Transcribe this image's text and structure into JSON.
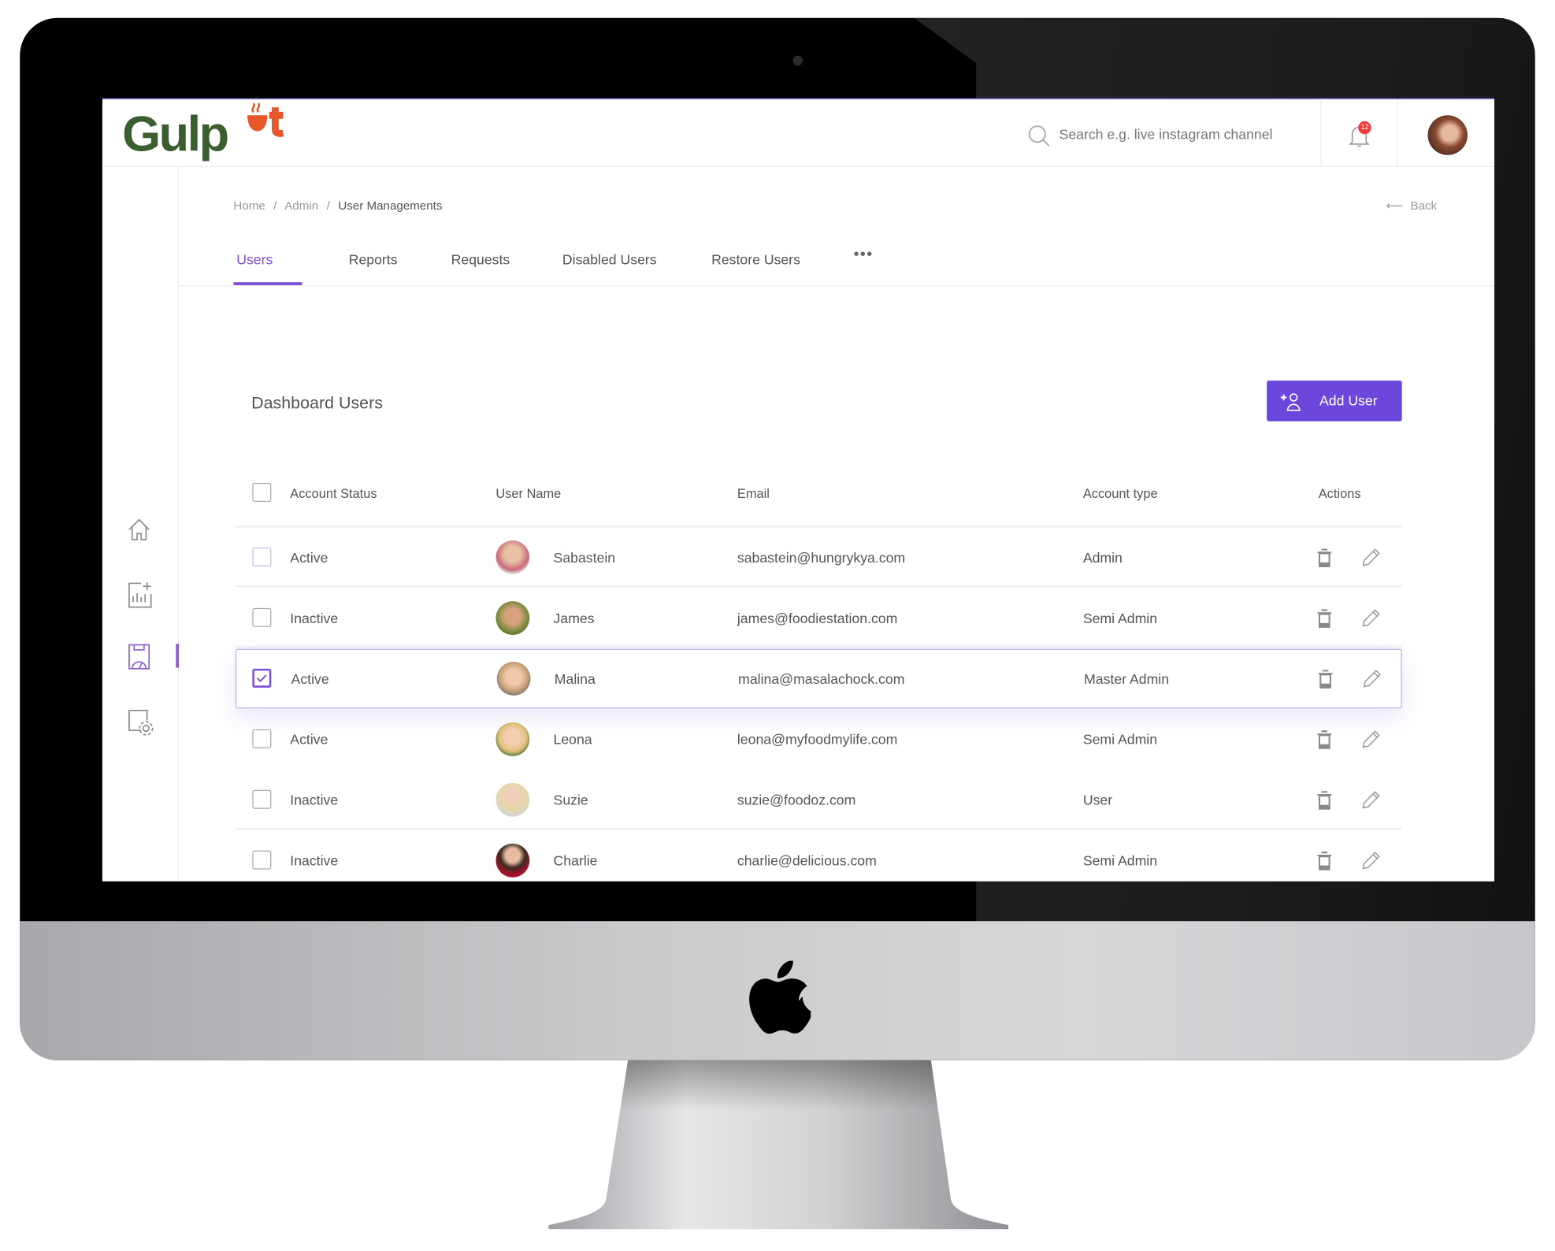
{
  "app": {
    "logo_text": "GulpOut",
    "brand_colors": {
      "green": "#3b5e31",
      "orange": "#e8572a",
      "accent": "#6c47dc"
    }
  },
  "header": {
    "search_placeholder": "Search e.g. live instagram channel",
    "notification_count": "12"
  },
  "sidebar": {
    "items": [
      {
        "icon": "home-icon"
      },
      {
        "icon": "chart-add-icon"
      },
      {
        "icon": "dashboard-icon",
        "active": true
      },
      {
        "icon": "settings-file-icon"
      }
    ]
  },
  "breadcrumb": {
    "items": [
      "Home",
      "Admin",
      "User Managements"
    ],
    "separator": "/"
  },
  "back_label": "Back",
  "tabs": [
    {
      "label": "Users",
      "active": true
    },
    {
      "label": "Reports"
    },
    {
      "label": "Requests"
    },
    {
      "label": "Disabled Users"
    },
    {
      "label": "Restore Users"
    }
  ],
  "more_label": "•••",
  "section": {
    "title": "Dashboard Users",
    "add_button": "Add User"
  },
  "table": {
    "columns": [
      "Account Status",
      "User Name",
      "Email",
      "Account type",
      "Actions"
    ],
    "rows": [
      {
        "status": "Active",
        "name": "Sabastein",
        "email": "sabastein@hungrykya.com",
        "type": "Admin",
        "checked": false
      },
      {
        "status": "Inactive",
        "name": "James",
        "email": "james@foodiestation.com",
        "type": "Semi Admin",
        "checked": false
      },
      {
        "status": "Active",
        "name": "Malina",
        "email": "malina@masalachock.com",
        "type": "Master Admin",
        "checked": true
      },
      {
        "status": "Active",
        "name": "Leona",
        "email": "leona@myfoodmylife.com",
        "type": "Semi Admin",
        "checked": false
      },
      {
        "status": "Inactive",
        "name": "Suzie",
        "email": "suzie@foodoz.com",
        "type": "User",
        "checked": false
      },
      {
        "status": "Inactive",
        "name": "Charlie",
        "email": "charlie@delicious.com",
        "type": "Semi Admin",
        "checked": false
      }
    ]
  }
}
